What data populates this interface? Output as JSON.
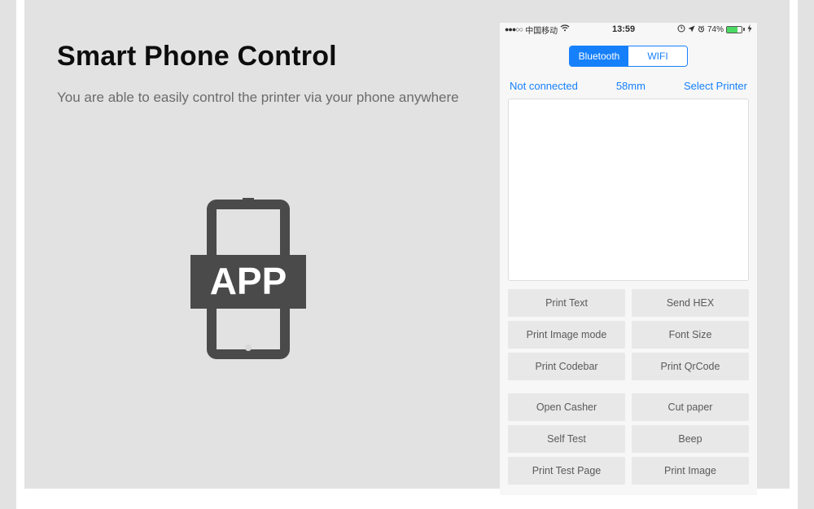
{
  "heading": "Smart Phone Control",
  "subheading": "You are able to easily control the printer via your phone anywhere",
  "app_label": "APP",
  "status": {
    "carrier": "中国移动",
    "time": "13:59",
    "battery_pct": "74%"
  },
  "segmented": {
    "bluetooth": "Bluetooth",
    "wifi": "WIFI"
  },
  "info": {
    "status": "Not connected",
    "width": "58mm",
    "select": "Select Printer"
  },
  "buttons": {
    "print_text": "Print Text",
    "send_hex": "Send HEX",
    "print_image_mode": "Print Image mode",
    "font_size": "Font Size",
    "print_codebar": "Print Codebar",
    "print_qrcode": "Print QrCode",
    "open_casher": "Open Casher",
    "cut_paper": "Cut paper",
    "self_test": "Self Test",
    "beep": "Beep",
    "print_test_page": "Print Test Page",
    "print_image": "Print Image"
  }
}
